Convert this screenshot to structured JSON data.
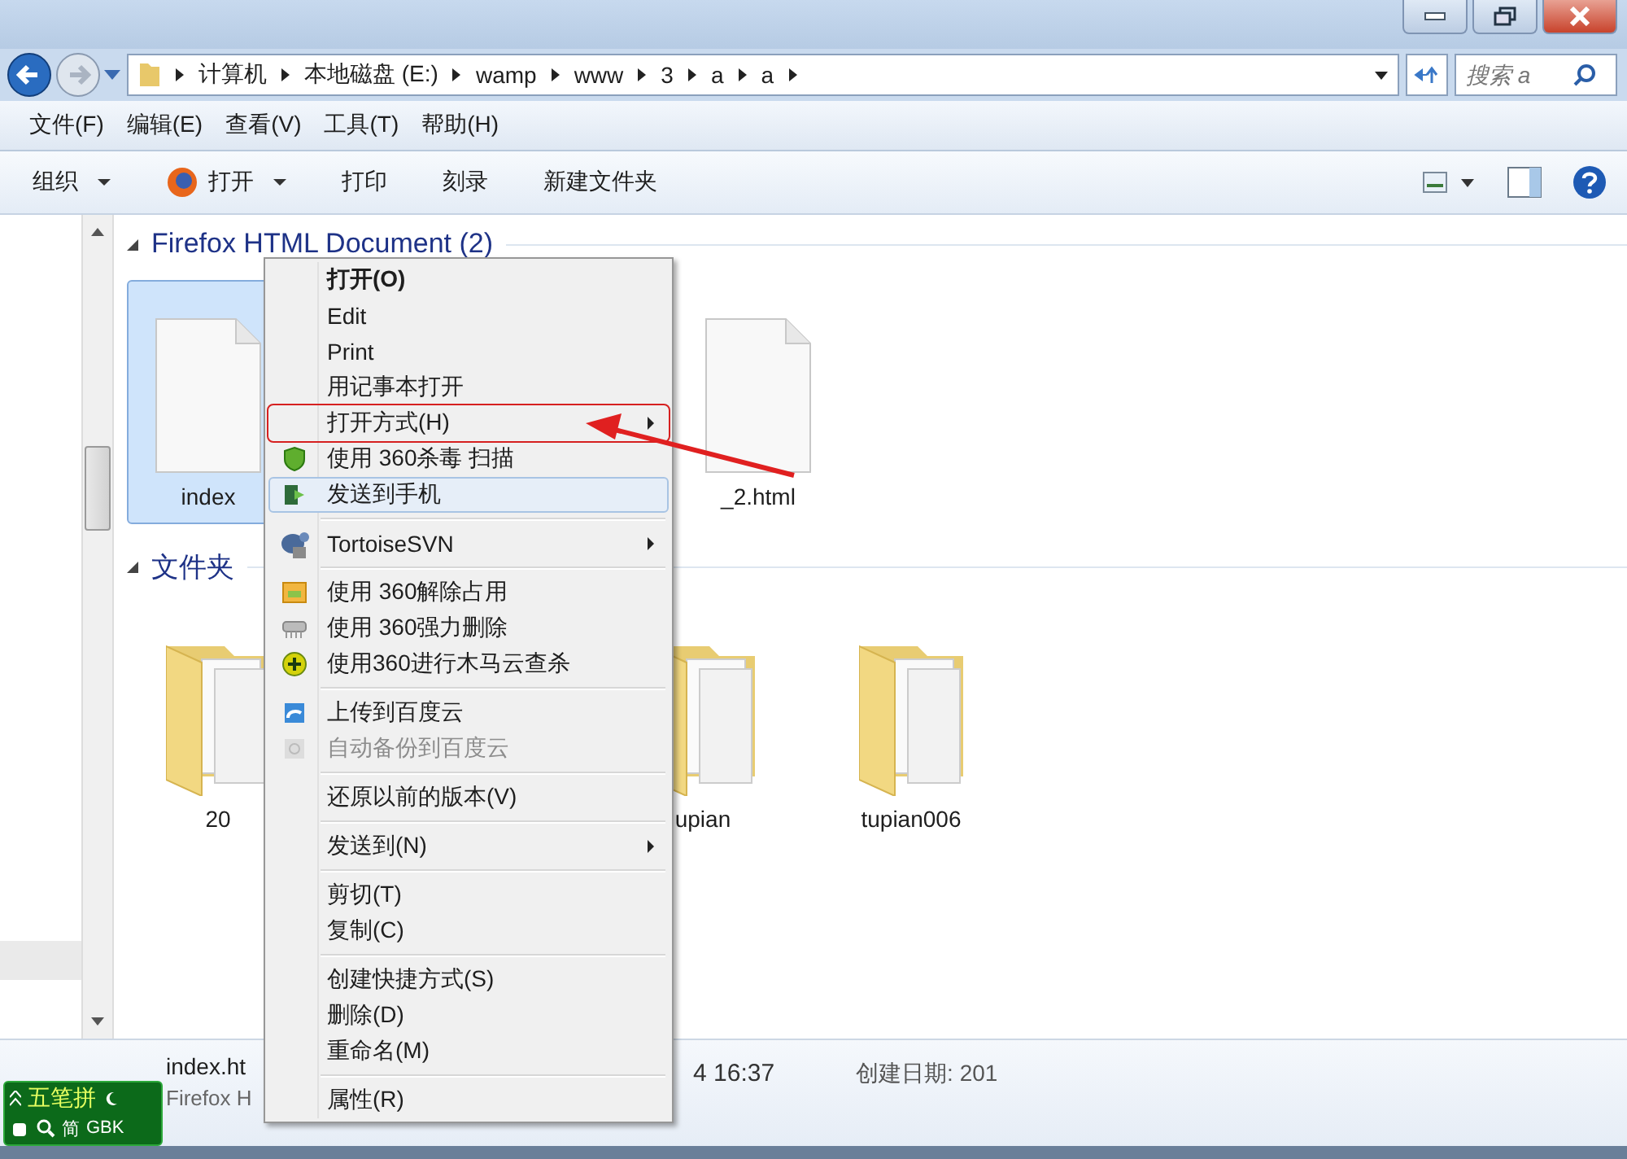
{
  "address_bar": {
    "crumbs": [
      "计算机",
      "本地磁盘 (E:)",
      "wamp",
      "www",
      "3",
      "a",
      "a"
    ]
  },
  "search": {
    "placeholder": "搜索 a"
  },
  "menu_bar": [
    "文件(F)",
    "编辑(E)",
    "查看(V)",
    "工具(T)",
    "帮助(H)"
  ],
  "toolbar": [
    {
      "label": "组织",
      "dropdown": true,
      "kind": "plain"
    },
    {
      "label": "打开",
      "dropdown": true,
      "kind": "app"
    },
    {
      "label": "打印",
      "dropdown": false,
      "kind": "plain"
    },
    {
      "label": "刻录",
      "dropdown": false,
      "kind": "plain"
    },
    {
      "label": "新建文件夹",
      "dropdown": false,
      "kind": "plain"
    }
  ],
  "groups": [
    {
      "title": "Firefox HTML Document (2)",
      "items": [
        {
          "name": "index",
          "kind": "document",
          "selected": true
        },
        {
          "name": "_2.html",
          "kind": "document",
          "selected": false
        }
      ]
    },
    {
      "title": "文件夹",
      "items": [
        {
          "name": "20",
          "kind": "folder",
          "selected": false
        },
        {
          "name": "upian",
          "kind": "folder",
          "selected": false
        },
        {
          "name": "tupian006",
          "kind": "folder",
          "selected": false
        }
      ]
    }
  ],
  "details": {
    "name": "index.ht",
    "type": "Firefox H",
    "modified": "4 16:37",
    "created": "创建日期: 201"
  },
  "ime": {
    "name": "五笔拼",
    "mode": "简",
    "charset": "GBK"
  },
  "context_menu": [
    {
      "kind": "item",
      "label": "打开(O)",
      "bold": true,
      "disabled": false,
      "submenu": false,
      "selected": false,
      "outlined": false
    },
    {
      "kind": "item",
      "label": "Edit",
      "bold": false,
      "disabled": false,
      "submenu": false,
      "selected": false,
      "outlined": false
    },
    {
      "kind": "item",
      "label": "Print",
      "bold": false,
      "disabled": false,
      "submenu": false,
      "selected": false,
      "outlined": false
    },
    {
      "kind": "item",
      "label": "用记事本打开",
      "bold": false,
      "disabled": false,
      "submenu": false,
      "selected": false,
      "outlined": false
    },
    {
      "kind": "item",
      "label": "打开方式(H)",
      "bold": false,
      "disabled": false,
      "submenu": true,
      "selected": false,
      "outlined": true
    },
    {
      "kind": "item",
      "label": "使用 360杀毒 扫描",
      "bold": false,
      "disabled": false,
      "submenu": false,
      "selected": false,
      "outlined": false
    },
    {
      "kind": "item",
      "label": "发送到手机",
      "bold": false,
      "disabled": false,
      "submenu": false,
      "selected": true,
      "outlined": false
    },
    {
      "kind": "separator"
    },
    {
      "kind": "item",
      "label": "TortoiseSVN",
      "bold": false,
      "disabled": false,
      "submenu": true,
      "selected": false,
      "outlined": false
    },
    {
      "kind": "separator"
    },
    {
      "kind": "item",
      "label": "使用 360解除占用",
      "bold": false,
      "disabled": false,
      "submenu": false,
      "selected": false,
      "outlined": false
    },
    {
      "kind": "item",
      "label": "使用 360强力删除",
      "bold": false,
      "disabled": false,
      "submenu": false,
      "selected": false,
      "outlined": false
    },
    {
      "kind": "item",
      "label": "使用360进行木马云查杀",
      "bold": false,
      "disabled": false,
      "submenu": false,
      "selected": false,
      "outlined": false
    },
    {
      "kind": "separator"
    },
    {
      "kind": "item",
      "label": "上传到百度云",
      "bold": false,
      "disabled": false,
      "submenu": false,
      "selected": false,
      "outlined": false
    },
    {
      "kind": "item",
      "label": "自动备份到百度云",
      "bold": false,
      "disabled": true,
      "submenu": false,
      "selected": false,
      "outlined": false
    },
    {
      "kind": "separator"
    },
    {
      "kind": "item",
      "label": "还原以前的版本(V)",
      "bold": false,
      "disabled": false,
      "submenu": false,
      "selected": false,
      "outlined": false
    },
    {
      "kind": "separator"
    },
    {
      "kind": "item",
      "label": "发送到(N)",
      "bold": false,
      "disabled": false,
      "submenu": true,
      "selected": false,
      "outlined": false
    },
    {
      "kind": "separator"
    },
    {
      "kind": "item",
      "label": "剪切(T)",
      "bold": false,
      "disabled": false,
      "submenu": false,
      "selected": false,
      "outlined": false
    },
    {
      "kind": "item",
      "label": "复制(C)",
      "bold": false,
      "disabled": false,
      "submenu": false,
      "selected": false,
      "outlined": false
    },
    {
      "kind": "separator"
    },
    {
      "kind": "item",
      "label": "创建快捷方式(S)",
      "bold": false,
      "disabled": false,
      "submenu": false,
      "selected": false,
      "outlined": false
    },
    {
      "kind": "item",
      "label": "删除(D)",
      "bold": false,
      "disabled": false,
      "submenu": false,
      "selected": false,
      "outlined": false
    },
    {
      "kind": "item",
      "label": "重命名(M)",
      "bold": false,
      "disabled": false,
      "submenu": false,
      "selected": false,
      "outlined": false
    },
    {
      "kind": "separator"
    },
    {
      "kind": "item",
      "label": "属性(R)",
      "bold": false,
      "disabled": false,
      "submenu": false,
      "selected": false,
      "outlined": false
    }
  ]
}
